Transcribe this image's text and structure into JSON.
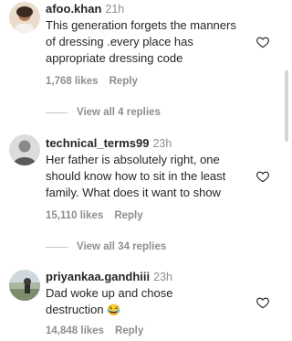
{
  "comments": [
    {
      "username": "afoo.khan",
      "time": "21h",
      "text": "This generation forgets the manners of dressing .every place has appropriate dressing code",
      "likes": "1,768 likes",
      "reply": "Reply",
      "view_replies": "View all 4 replies"
    },
    {
      "username": "technical_terms99",
      "time": "23h",
      "text": "Her father is absolutely right, one should know how to sit in the least family. What does it want to show",
      "likes": "15,110 likes",
      "reply": "Reply",
      "view_replies": "View all 34 replies"
    },
    {
      "username": "priyankaa.gandhiii",
      "time": "23h",
      "text": "Dad woke up and chose destruction",
      "emoji": "😂",
      "likes": "14,848 likes",
      "reply": "Reply"
    }
  ],
  "icons": {
    "like": "heart-outline-icon"
  },
  "colors": {
    "primary_text": "#262626",
    "secondary_text": "#8e8e8e"
  }
}
